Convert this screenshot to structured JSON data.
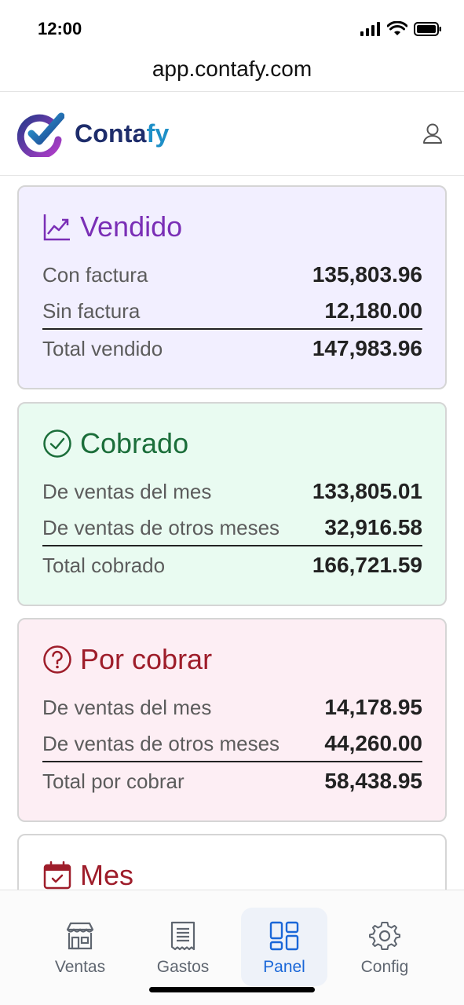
{
  "status_bar": {
    "time": "12:00"
  },
  "browser": {
    "url": "app.contafy.com"
  },
  "header": {
    "brand_prefix": "Conta",
    "brand_suffix": "fy",
    "user_icon": "user-icon"
  },
  "cards": {
    "sales": {
      "title": "Vendido",
      "icon": "trending-up-icon",
      "color": "#7a2fb6",
      "rows": [
        {
          "label": "Con factura",
          "value": "135,803.96"
        },
        {
          "label": "Sin factura",
          "value": "12,180.00"
        }
      ],
      "total": {
        "label": "Total vendido",
        "value": "147,983.96"
      }
    },
    "collected": {
      "title": "Cobrado",
      "icon": "check-circle-icon",
      "color": "#1b6e3a",
      "rows": [
        {
          "label": "De ventas del mes",
          "value": "133,805.01"
        },
        {
          "label": "De ventas de otros meses",
          "value": "32,916.58"
        }
      ],
      "total": {
        "label": "Total cobrado",
        "value": "166,721.59"
      }
    },
    "pending": {
      "title": "Por cobrar",
      "icon": "question-circle-icon",
      "color": "#9e1d2a",
      "rows": [
        {
          "label": "De ventas del mes",
          "value": "14,178.95"
        },
        {
          "label": "De ventas de otros meses",
          "value": "44,260.00"
        }
      ],
      "total": {
        "label": "Total por cobrar",
        "value": "58,438.95"
      }
    },
    "month": {
      "title": "Mes",
      "icon": "calendar-check-icon"
    }
  },
  "nav": {
    "items": [
      {
        "label": "Ventas",
        "icon": "store-icon",
        "active": false
      },
      {
        "label": "Gastos",
        "icon": "receipt-icon",
        "active": false
      },
      {
        "label": "Panel",
        "icon": "dashboard-icon",
        "active": true
      },
      {
        "label": "Config",
        "icon": "gear-icon",
        "active": false
      }
    ],
    "active_color": "#1a67d8"
  }
}
